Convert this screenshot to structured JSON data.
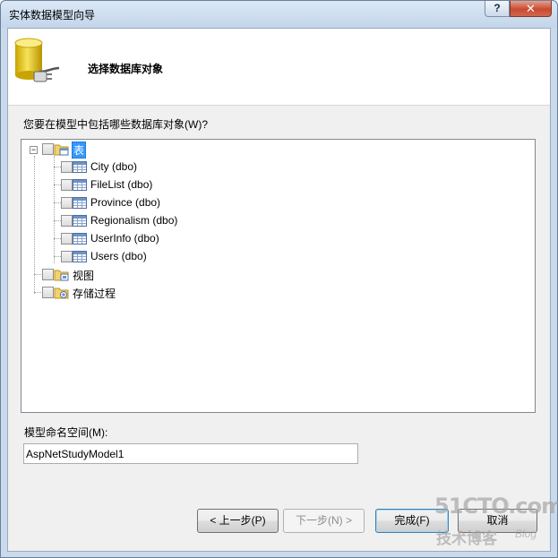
{
  "window": {
    "title": "实体数据模型向导",
    "help_label": "?",
    "close_label": "✕"
  },
  "header": {
    "title": "选择数据库对象",
    "icon": "database-plug-icon"
  },
  "prompt": "您要在模型中包括哪些数据库对象(W)?",
  "tree": {
    "root": {
      "expander": "−",
      "label": "表",
      "checked": false,
      "children": [
        {
          "label": "City (dbo)",
          "checked": false
        },
        {
          "label": "FileList (dbo)",
          "checked": false
        },
        {
          "label": "Province (dbo)",
          "checked": false
        },
        {
          "label": "Regionalism (dbo)",
          "checked": false
        },
        {
          "label": "UserInfo (dbo)",
          "checked": false
        },
        {
          "label": "Users (dbo)",
          "checked": false
        }
      ]
    },
    "views": {
      "label": "视图",
      "checked": false
    },
    "procedures": {
      "label": "存储过程",
      "checked": false
    }
  },
  "namespace": {
    "label": "模型命名空间(M):",
    "value": "AspNetStudyModel1"
  },
  "buttons": {
    "back": "< 上一步(P)",
    "next": "下一步(N) >",
    "finish": "完成(F)",
    "cancel": "取消"
  },
  "watermark": {
    "top": "51CTO.com",
    "bottom": "技术博客",
    "blog": "Blog"
  },
  "colors": {
    "selection": "#3399ff",
    "titlebar": "#c9daed",
    "close_button": "#c84b31"
  }
}
